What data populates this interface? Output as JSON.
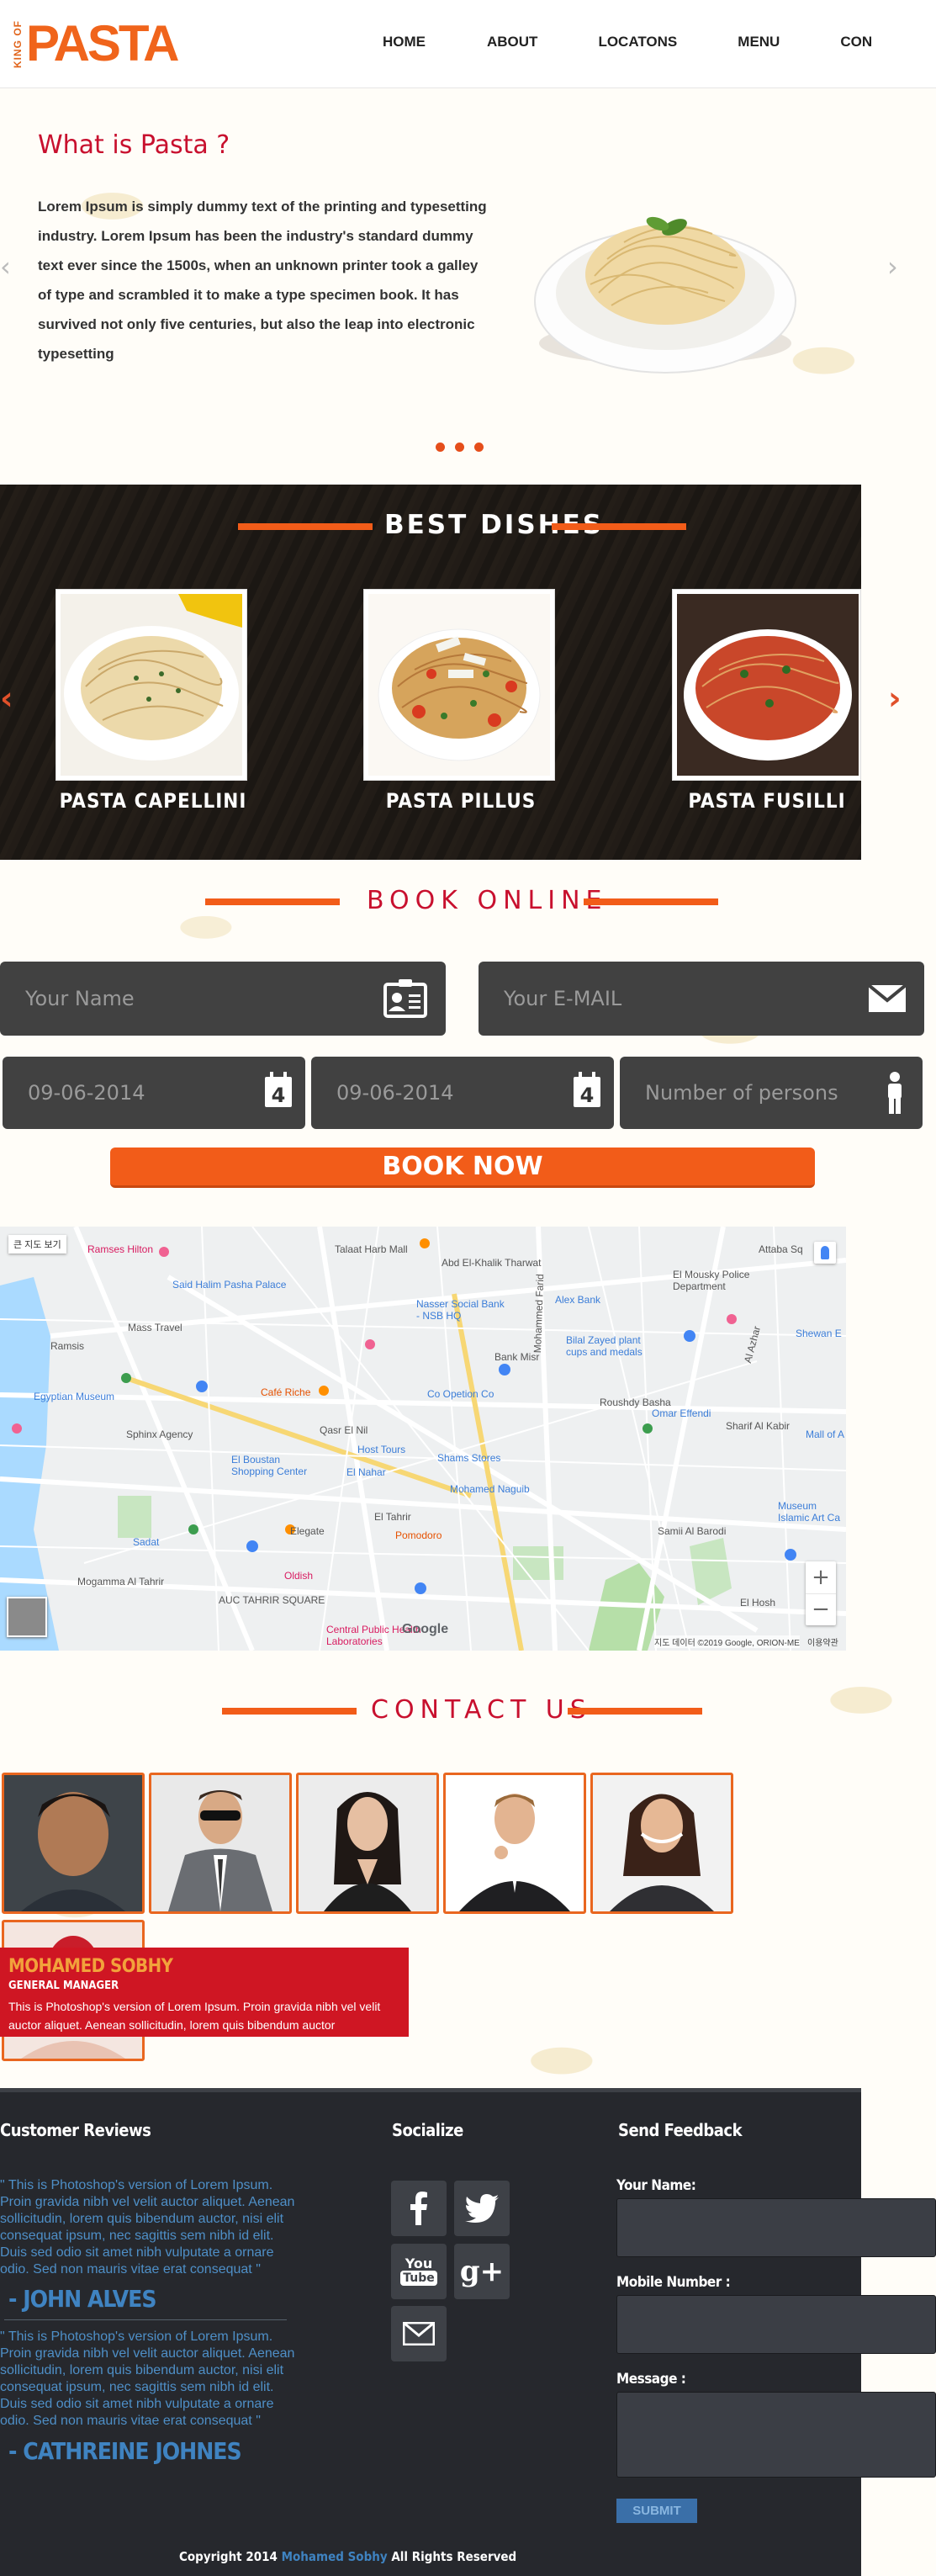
{
  "brand": {
    "small": "KING OF",
    "big": "PASTA"
  },
  "nav": {
    "items": [
      "HOME",
      "ABOUT",
      "LOCATONS",
      "MENU",
      "CON"
    ]
  },
  "hero": {
    "title": "What is Pasta ?",
    "text": "Lorem Ipsum is simply dummy text of the printing and typesetting industry. Lorem Ipsum has been the industry's standard dummy text ever since the 1500s, when an unknown printer took a galley of type and scrambled it to make a type specimen book. It has survived not only five centuries, but also the leap into electronic typesetting",
    "slides": 3
  },
  "best_dishes": {
    "title": "BEST DISHES",
    "items": [
      {
        "name": "PASTA CAPELLINI"
      },
      {
        "name": "PASTA PILLUS"
      },
      {
        "name": "PASTA FUSILLI"
      }
    ]
  },
  "booking": {
    "title": "BOOK ONLINE",
    "name_placeholder": "Your Name",
    "email_placeholder": "Your E-MAIL",
    "date_from": "09-06-2014",
    "date_to": "09-06-2014",
    "persons_placeholder": "Number of persons",
    "calendar_day": "4",
    "button": "BOOK NOW"
  },
  "map": {
    "streetview_label": "큰 지도 보기",
    "attribution": "지도 데이터 ©2019 Google, ORION-ME",
    "terms": "이용약관",
    "google": "Google",
    "zoom_in": "+",
    "zoom_out": "−",
    "places": [
      "Ramses Hilton",
      "Talaat Harb Mall",
      "Abd El-Khalik Tharwat",
      "Attaba Sq",
      "Said Halim Pasha Palace",
      "El Mousky Police Department",
      "Mass Travel",
      "Nasser Social Bank - NSB HQ",
      "Alex Bank",
      "Bilal Zayed plant cups and medals",
      "Shewan E",
      "Ramsis",
      "Egyptian Museum",
      "Café Riche",
      "Co Opetion Co",
      "Roushdy Basha",
      "Omar Effendi",
      "Sharif Al Kabir",
      "Mall of A",
      "Sphinx Agency",
      "El Boustan Shopping Center",
      "Host Tours",
      "Shams Stores",
      "El Nahar",
      "Mohamed Naguib",
      "Museum Islamic Art Ca",
      "Sadat",
      "El Tahrir",
      "Pomodoro",
      "Elegate",
      "Mogamma Al Tahrir",
      "Samii Al Barodi",
      "Oldish",
      "AUC TAHRIR SQUARE",
      "Central Public Health Laboratories",
      "Mohammed Farid",
      "Al Azhar",
      "Qasr El Nil",
      "Bank Misr",
      "El Hosh"
    ]
  },
  "contact": {
    "title": "CONTACT US",
    "featured": {
      "name": "MOHAMED SOBHY",
      "role": "GENERAL MANAGER",
      "bio": "This is Photoshop's version  of Lorem Ipsum. Proin gravida nibh vel velit auctor aliquet. Aenean sollicitudin, lorem quis bibendum auctor"
    }
  },
  "footer": {
    "reviews_title": "Customer Reviews",
    "reviews": [
      {
        "text": "\" This is Photoshop's version of Lorem Ipsum. Proin gravida nibh vel velit auctor aliquet. Aenean sollicitudin, lorem quis bibendum auctor, nisi elit consequat ipsum, nec sagittis sem nibh id elit. Duis sed odio sit amet nibh vulputate a ornare odio. Sed non mauris vitae erat consequat \"",
        "author": "- JOHN ALVES"
      },
      {
        "text": "\" This is Photoshop's version of Lorem Ipsum. Proin gravida nibh vel velit auctor aliquet. Aenean sollicitudin, lorem quis bibendum auctor, nisi elit consequat ipsum, nec sagittis sem nibh id elit. Duis sed odio sit amet nibh vulputate a ornare odio. Sed non mauris vitae erat consequat \"",
        "author": "- CATHREINE JOHNES"
      }
    ],
    "socialize_title": "Socialize",
    "youtube_top": "You",
    "youtube_bottom": "Tube",
    "gplus": "g+",
    "feedback_title": "Send Feedback",
    "name_label": "Your Name:",
    "mobile_label": "Mobile Number :",
    "message_label": "Message :",
    "submit": "SUBMIT",
    "copyright_pre": "Copyright 2014",
    "copyright_name": "Mohamed Sobhy",
    "copyright_post": "All Rights Reserved"
  },
  "colors": {
    "accent": "#f25c19",
    "red": "#c8102e",
    "footer_bg": "#26282d",
    "field_bg": "#414141"
  }
}
